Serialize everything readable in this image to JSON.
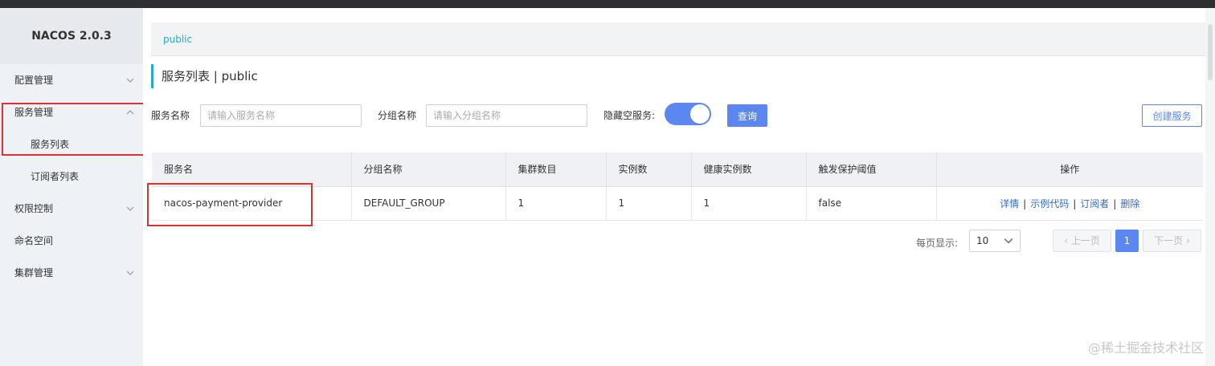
{
  "app": {
    "title": "NACOS 2.0.3"
  },
  "sidebar": {
    "items": [
      {
        "label": "配置管理"
      },
      {
        "label": "服务管理"
      },
      {
        "label": "服务列表"
      },
      {
        "label": "订阅者列表"
      },
      {
        "label": "权限控制"
      },
      {
        "label": "命名空间"
      },
      {
        "label": "集群管理"
      }
    ]
  },
  "breadcrumb": {
    "namespace": "public"
  },
  "page": {
    "title": "服务列表  |  public"
  },
  "filters": {
    "service_name_label": "服务名称",
    "service_name_placeholder": "请输入服务名称",
    "group_name_label": "分组名称",
    "group_name_placeholder": "请输入分组名称",
    "hide_empty_label": "隐藏空服务:",
    "hide_empty_on": true,
    "query_button": "查询",
    "create_button": "创建服务"
  },
  "table": {
    "columns": [
      "服务名",
      "分组名称",
      "集群数目",
      "实例数",
      "健康实例数",
      "触发保护阈值",
      "操作"
    ],
    "rows": [
      {
        "service": "nacos-payment-provider",
        "group": "DEFAULT_GROUP",
        "clusters": "1",
        "instances": "1",
        "healthy": "1",
        "threshold": "false",
        "actions": [
          "详情",
          "示例代码",
          "订阅者",
          "删除"
        ]
      }
    ]
  },
  "pagination": {
    "page_size_label": "每页显示:",
    "page_size": "10",
    "prev": "上一页",
    "next": "下一页",
    "current": "1"
  },
  "watermark": "@稀土掘金技术社区",
  "colors": {
    "accent": "#5c87f1",
    "link": "#2f6bd6",
    "highlight": "#e03030",
    "breadcrumb": "#22aac8"
  }
}
